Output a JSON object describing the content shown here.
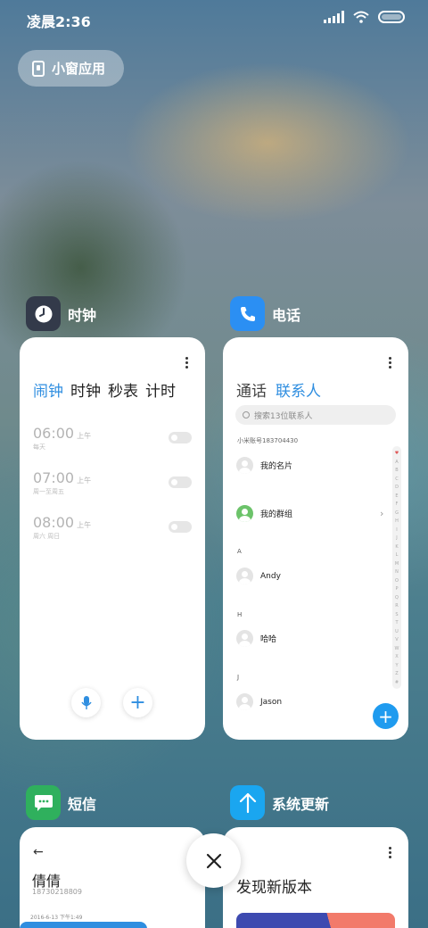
{
  "status_bar": {
    "time": "凌晨2:36"
  },
  "floating_window": {
    "label": "小窗应用"
  },
  "apps": {
    "clock": {
      "name": "时钟",
      "tabs": [
        "闹钟",
        "时钟",
        "秒表",
        "计时"
      ],
      "alarms": [
        {
          "time": "06:00",
          "ampm": "上午",
          "repeat": "每天"
        },
        {
          "time": "07:00",
          "ampm": "上午",
          "repeat": "周一至周五"
        },
        {
          "time": "08:00",
          "ampm": "上午",
          "repeat": "周六 周日"
        }
      ]
    },
    "phone": {
      "name": "电话",
      "tabs": [
        "通话",
        "联系人"
      ],
      "search_placeholder": "搜索13位联系人",
      "account": "小米账号183704430",
      "my_card": "我的名片",
      "my_groups": "我的群组",
      "sections": [
        {
          "letter": "A",
          "name": "Andy"
        },
        {
          "letter": "H",
          "name": "哈哈"
        },
        {
          "letter": "J",
          "name": "Jason"
        }
      ],
      "index_letters": [
        "♥",
        "A",
        "B",
        "C",
        "D",
        "E",
        "F",
        "G",
        "H",
        "I",
        "J",
        "K",
        "L",
        "M",
        "N",
        "O",
        "P",
        "Q",
        "R",
        "S",
        "T",
        "U",
        "V",
        "W",
        "X",
        "Y",
        "Z",
        "#"
      ]
    },
    "sms": {
      "name": "短信",
      "contact": "倩倩",
      "number": "18730218809",
      "date": "2016-6-13 下午1:49"
    },
    "update": {
      "name": "系统更新",
      "headline": "发现新版本"
    }
  },
  "colors": {
    "accent": "#2f8ee0",
    "clock_icon_bg": "#333a4a",
    "phone_icon_bg": "#2b8ff3",
    "sms_icon_bg": "#2fb05d",
    "update_icon_bg": "#1aa6f0"
  },
  "icons": {
    "close": "close-icon",
    "clock": "clock-icon",
    "phone": "phone-icon",
    "sms": "message-icon",
    "update": "arrow-up-icon"
  }
}
